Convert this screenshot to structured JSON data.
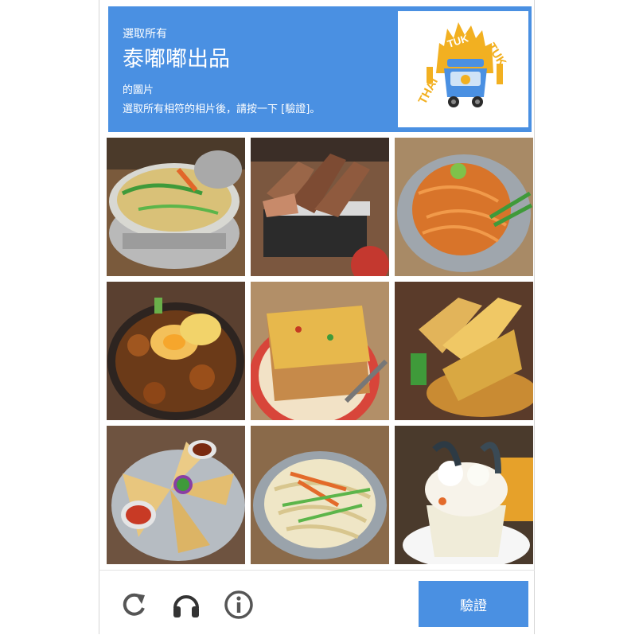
{
  "challenge": {
    "select_prompt": "選取所有",
    "target": "泰嘟嘟出品",
    "suffix": "的圖片",
    "instructions": "選取所有相符的相片後，請按一下 [驗證]。"
  },
  "logo": {
    "word1": "THAI",
    "word2": "TUK",
    "word3": "TUK",
    "accent": "#f2b021",
    "vehicle": "#4a90e2"
  },
  "tiles": [
    {
      "dish": "hot-pot"
    },
    {
      "dish": "grilled-pork"
    },
    {
      "dish": "pad-thai-red"
    },
    {
      "dish": "braised-eggs"
    },
    {
      "dish": "curry-toast"
    },
    {
      "dish": "garlic-bread"
    },
    {
      "dish": "spring-rolls"
    },
    {
      "dish": "stir-fried-noodles"
    },
    {
      "dish": "coconut-dessert"
    }
  ],
  "footer": {
    "verify_label": "驗證",
    "icons": [
      "reload-icon",
      "headphones-icon",
      "info-icon"
    ]
  },
  "colors": {
    "header_bg": "#4a90e2",
    "button_bg": "#4a90e2"
  }
}
